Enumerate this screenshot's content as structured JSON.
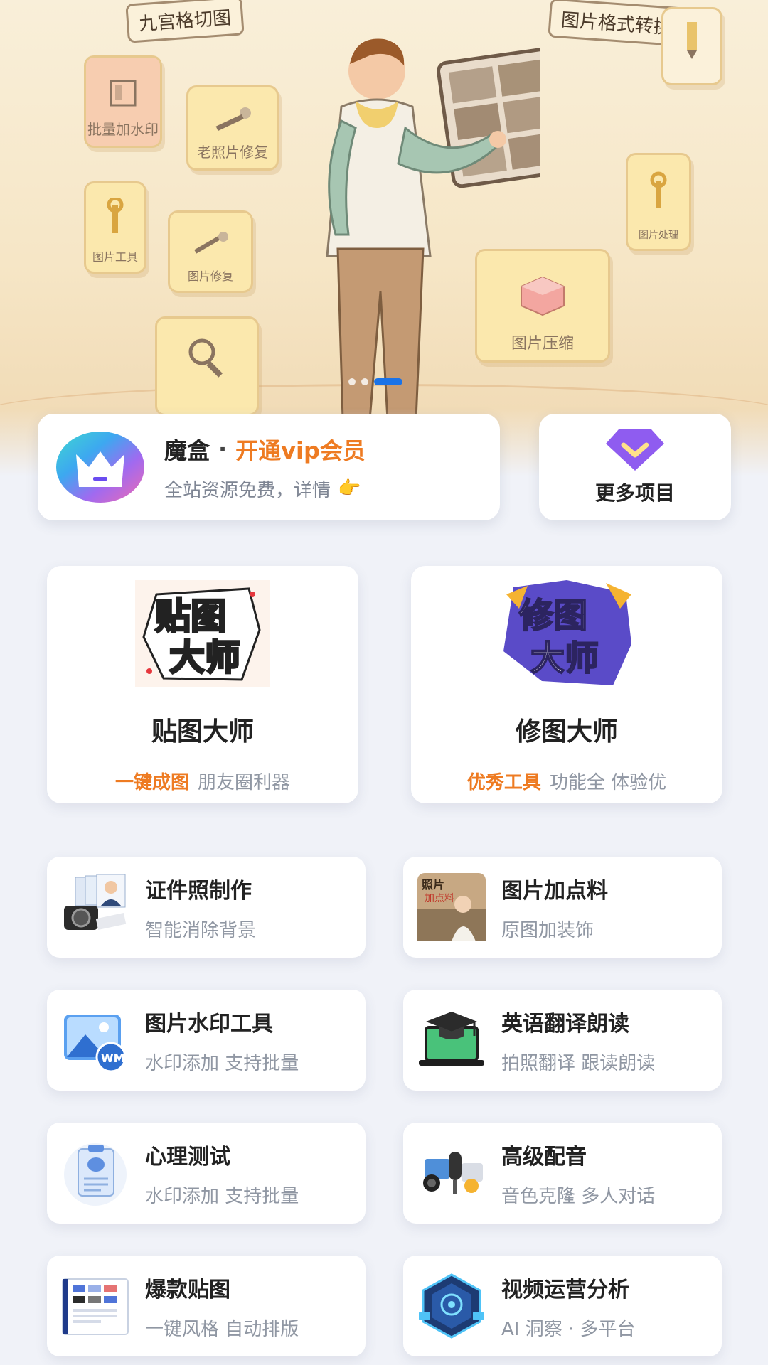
{
  "banner": {
    "tiles": {
      "grid9": "九宫格切图",
      "format": "图片格式转换",
      "watermark": "批量加水印",
      "repair": "老照片修复",
      "compress": "图片压缩",
      "tool": "图片工具",
      "tool2": "图片修复",
      "tool3": "图片处理"
    },
    "carousel": {
      "count": 3,
      "active_index": 2
    }
  },
  "vip": {
    "brand": "魔盒",
    "separator": "·",
    "cta": "开通vip会员",
    "subtitle": "全站资源免费，详情",
    "pointer_emoji": "👉",
    "icon": "crown-logo"
  },
  "more": {
    "label": "更多项目",
    "icon": "diamond-chevron-icon"
  },
  "featured": [
    {
      "title": "贴图大师",
      "highlight": "一键成图",
      "desc": "朋友圈利器",
      "art_text": [
        "贴图",
        "大师"
      ]
    },
    {
      "title": "修图大师",
      "highlight": "优秀工具",
      "desc": "功能全 体验优",
      "art_text": [
        "修图",
        "大师"
      ]
    }
  ],
  "tools": [
    {
      "title": "证件照制作",
      "desc": "智能消除背景",
      "icon": "id-photo-camera-icon"
    },
    {
      "title": "图片加点料",
      "desc": "原图加装饰",
      "icon": "photo-decorate-thumb"
    },
    {
      "title": "图片水印工具",
      "desc": "水印添加 支持批量",
      "icon": "watermark-image-icon"
    },
    {
      "title": "英语翻译朗读",
      "desc": "拍照翻译 跟读朗读",
      "icon": "graduation-laptop-icon"
    },
    {
      "title": "心理测试",
      "desc": "水印添加 支持批量",
      "icon": "brain-clipboard-icon"
    },
    {
      "title": "高级配音",
      "desc": "音色克隆 多人对话",
      "icon": "microphone-studio-icon"
    },
    {
      "title": "爆款贴图",
      "desc": "一键风格 自动排版",
      "icon": "dashboard-screenshot-icon"
    },
    {
      "title": "视频运营分析",
      "desc": "AI 洞察 · 多平台",
      "icon": "ai-analysis-badge-icon"
    }
  ],
  "colors": {
    "accent_orange": "#ee7b22",
    "active_dot": "#1a73e8",
    "page_bg": "#f0f2f8",
    "diamond": "#8f5cf0"
  }
}
